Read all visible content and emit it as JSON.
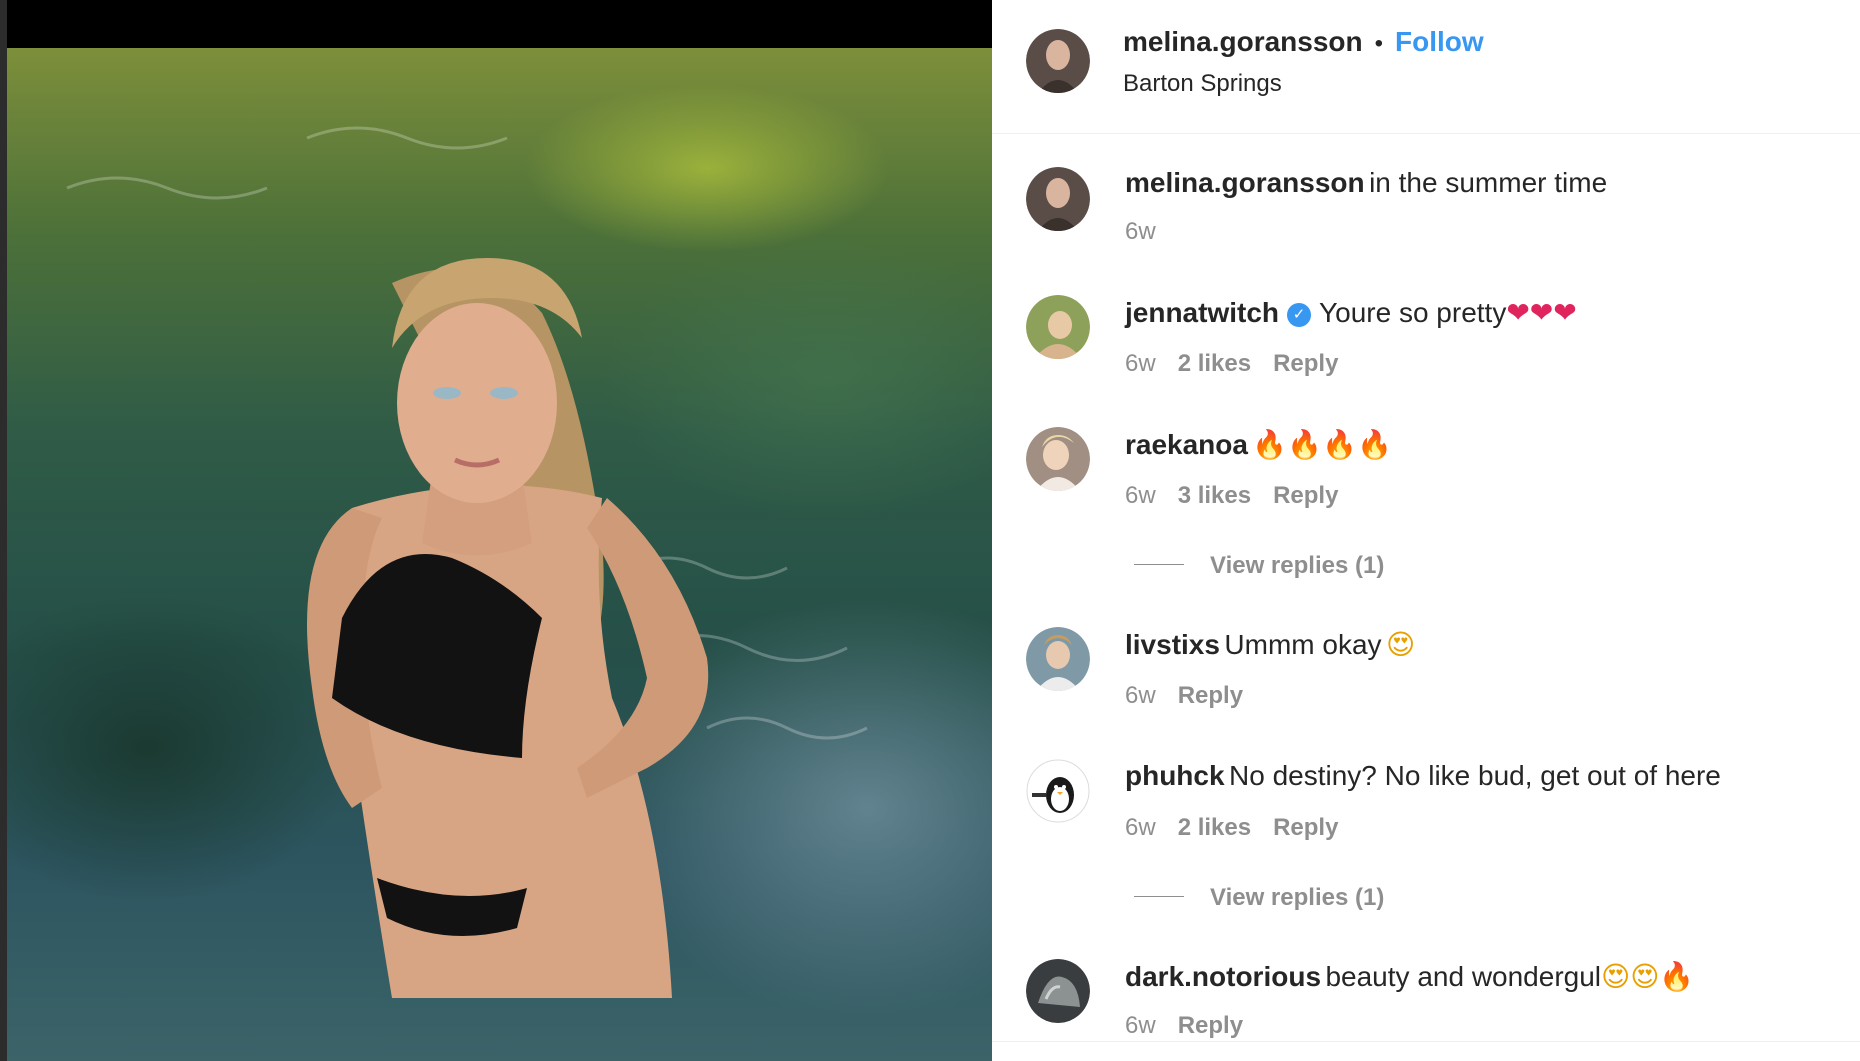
{
  "post": {
    "author": "melina.goransson",
    "separator": "•",
    "follow_label": "Follow",
    "location": "Barton Springs"
  },
  "caption": {
    "username": "melina.goransson",
    "text": "in the summer time",
    "age": "6w"
  },
  "comments": [
    {
      "username": "jennatwitch",
      "verified": true,
      "text": "Youre so pretty",
      "emoji": "❤❤❤",
      "age": "6w",
      "likes": "2 likes",
      "reply_label": "Reply"
    },
    {
      "username": "raekanoa",
      "text": "",
      "emoji": "🔥🔥🔥🔥",
      "age": "6w",
      "likes": "3 likes",
      "reply_label": "Reply",
      "view_replies": "View replies (1)"
    },
    {
      "username": "livstixs",
      "text": "Ummm okay",
      "emoji": "😍",
      "age": "6w",
      "reply_label": "Reply"
    },
    {
      "username": "phuhck",
      "text": "No destiny? No like bud, get out of here",
      "age": "6w",
      "likes": "2 likes",
      "reply_label": "Reply",
      "view_replies": "View replies (1)"
    },
    {
      "username": "dark.notorious",
      "text": "beauty and wondergul",
      "emoji": "😍😍🔥",
      "age": "6w",
      "reply_label": "Reply"
    }
  ],
  "colors": {
    "accent": "#3897f0",
    "muted_text": "#8e8e8e",
    "primary_text": "#262626"
  },
  "icons": {
    "verified": "verified-badge-icon"
  }
}
